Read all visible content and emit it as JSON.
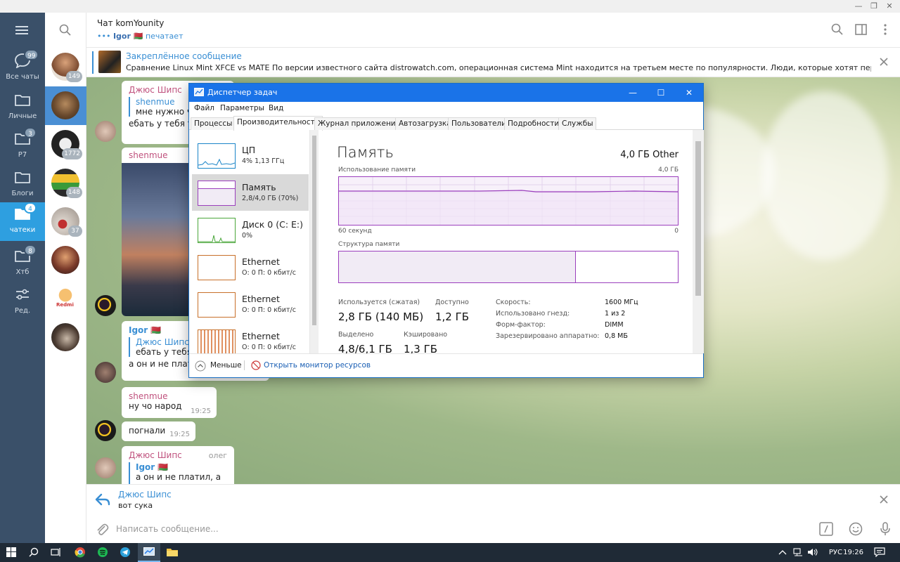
{
  "window": {
    "minimize": "—",
    "restore": "❐",
    "close": "✕"
  },
  "folders": [
    {
      "label": "Все чаты",
      "badge": "99",
      "icon": "chat-bubble-icon"
    },
    {
      "label": "Личные",
      "badge": "",
      "icon": "folder-icon"
    },
    {
      "label": "P7",
      "badge": "3",
      "icon": "folder-icon"
    },
    {
      "label": "Блоги",
      "badge": "",
      "icon": "folder-icon"
    },
    {
      "label": "чатеки",
      "badge": "4",
      "icon": "folder-icon"
    },
    {
      "label": "Хтб",
      "badge": "8",
      "icon": "folder-icon"
    },
    {
      "label": "Ред.",
      "badge": "",
      "icon": "sliders-icon"
    }
  ],
  "chats": [
    {
      "badge": "149"
    },
    {
      "badge": ""
    },
    {
      "badge": "1772"
    },
    {
      "badge": "148"
    },
    {
      "badge": "37"
    },
    {
      "badge": ""
    },
    {
      "badge": "",
      "label": "Redmi"
    },
    {
      "badge": ""
    }
  ],
  "header": {
    "title": "Чат komYounity",
    "typing_dots": "•••",
    "typing_user": "Igor 🇧🇾",
    "typing_status": "печатает"
  },
  "pinned": {
    "title": "Закреплённое сообщение",
    "text": "Сравнение Linux Mint XFCE vs MATE  По версии известного сайта distrowatch.com, операционная система Mint находится на третьем месте по популярности. Люди, которые хотят перейти..."
  },
  "messages": {
    "m1": {
      "sender": "Джюс Шипс",
      "quote_name": "shenmue",
      "quote_text": "мне нужно чт",
      "text": "ебать у тебя тр"
    },
    "m2": {
      "sender": "shenmue"
    },
    "m3": {
      "sender": "Igor 🇧🇾",
      "quote_name": "Джюс Шипс",
      "quote_text": "ебать у тебя",
      "text": "а он и не плати"
    },
    "m4": {
      "sender": "shenmue",
      "text": "ну чо народ",
      "time": "19:25"
    },
    "m5": {
      "text": "погнали",
      "time": "19:25"
    },
    "m6": {
      "sender": "Джюс Шипс",
      "side_name": "олег",
      "quote_name": "Igor 🇧🇾",
      "quote_text": "а он и не платил, а тр"
    }
  },
  "reply": {
    "name": "Джюс Шипс",
    "text": "вот сука"
  },
  "composer": {
    "placeholder": "Написать сообщение..."
  },
  "taskmanager": {
    "title": "Диспетчер задач",
    "menu": [
      "Файл",
      "Параметры",
      "Вид"
    ],
    "tabs": [
      "Процессы",
      "Производительность",
      "Журнал приложений",
      "Автозагрузка",
      "Пользователи",
      "Подробности",
      "Службы"
    ],
    "resources": [
      {
        "name": "ЦП",
        "value": "4%  1,13 ГГц",
        "color": "#1a85c8"
      },
      {
        "name": "Память",
        "value": "2,8/4,0 ГБ (70%)",
        "color": "#9b3fbd"
      },
      {
        "name": "Диск 0 (C: E:)",
        "value": "0%",
        "color": "#4aa63a"
      },
      {
        "name": "Ethernet",
        "value": "О: 0  П: 0 кбит/с",
        "color": "#c8702a"
      },
      {
        "name": "Ethernet",
        "value": "О: 0  П: 0 кбит/с",
        "color": "#c8702a"
      },
      {
        "name": "Ethernet",
        "value": "О: 0  П: 0 кбит/с",
        "color": "#c8702a"
      }
    ],
    "memory": {
      "title": "Память",
      "total": "4,0 ГБ Other",
      "usage_label": "Использование памяти",
      "usage_max": "4,0 ГБ",
      "seconds": "60 секунд",
      "zero": "0",
      "structure_label": "Структура памяти",
      "used_fraction": 0.7,
      "in_use_label": "Используется (сжатая)",
      "in_use_value": "2,8 ГБ (140 МБ)",
      "available_label": "Доступно",
      "available_value": "1,2 ГБ",
      "committed_label": "Выделено",
      "committed_value": "4,8/6,1 ГБ",
      "cached_label": "Кэшировано",
      "cached_value": "1,3 ГБ",
      "speed_label": "Скорость:",
      "speed_value": "1600 МГц",
      "slots_label": "Использовано гнезд:",
      "slots_value": "1 из 2",
      "form_label": "Форм-фактор:",
      "form_value": "DIMM",
      "reserved_label": "Зарезервировано аппаратно:",
      "reserved_value": "0,8 МБ"
    },
    "footer": {
      "less": "Меньше",
      "monitor": "Открыть монитор ресурсов"
    }
  },
  "taskbar": {
    "lang": "РУС",
    "time": "19:26"
  }
}
